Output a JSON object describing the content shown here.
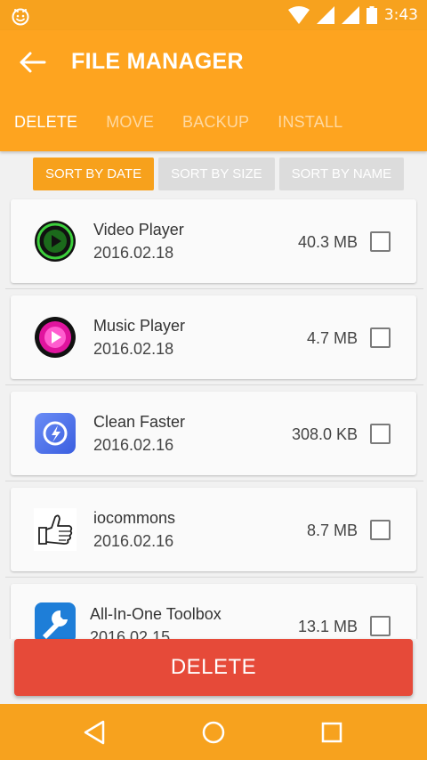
{
  "status_bar": {
    "time": "3:43",
    "icons": [
      "notification-smiley-icon",
      "wifi-icon",
      "signal-icon",
      "signal-icon",
      "battery-icon"
    ]
  },
  "app_bar": {
    "back_icon": "arrow-left-icon",
    "title": "FILE MANAGER",
    "tabs": [
      {
        "label": "DELETE",
        "active": true
      },
      {
        "label": "MOVE",
        "active": false
      },
      {
        "label": "BACKUP",
        "active": false
      },
      {
        "label": "INSTALL",
        "active": false
      }
    ]
  },
  "sort": {
    "buttons": [
      {
        "label": "SORT BY DATE",
        "active": true
      },
      {
        "label": "SORT BY SIZE",
        "active": false
      },
      {
        "label": "SORT BY NAME",
        "active": false
      }
    ]
  },
  "apps": [
    {
      "name": "Video Player",
      "date": "2016.02.18",
      "size": "40.3 MB",
      "icon": "video-player-icon",
      "checked": false
    },
    {
      "name": "Music Player",
      "date": "2016.02.18",
      "size": "4.7 MB",
      "icon": "music-player-icon",
      "checked": false
    },
    {
      "name": "Clean Faster",
      "date": "2016.02.16",
      "size": "308.0 KB",
      "icon": "clean-faster-icon",
      "checked": false
    },
    {
      "name": "iocommons",
      "date": "2016.02.16",
      "size": "8.7 MB",
      "icon": "thumbs-up-icon",
      "checked": false
    },
    {
      "name": "All-In-One Toolbox",
      "date": "2016.02.15",
      "size": "13.1 MB",
      "icon": "wrench-icon",
      "checked": false
    }
  ],
  "delete_button": {
    "label": "DELETE"
  },
  "nav_bar": {
    "icons": [
      "nav-back-icon",
      "nav-home-icon",
      "nav-recents-icon"
    ]
  },
  "colors": {
    "accent": "#fea41f",
    "sort_active": "#f7a11c",
    "delete": "#e64a39"
  }
}
